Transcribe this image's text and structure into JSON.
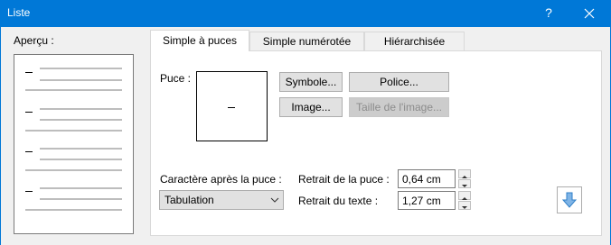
{
  "window": {
    "title": "Liste",
    "help_label": "?"
  },
  "preview": {
    "label": "Aperçu :"
  },
  "tabs": [
    {
      "label": "Simple à puces",
      "active": true
    },
    {
      "label": "Simple numérotée",
      "active": false
    },
    {
      "label": "Hiérarchisée",
      "active": false
    }
  ],
  "bullet": {
    "label": "Puce :",
    "symbol": "–"
  },
  "buttons": {
    "symbol": "Symbole...",
    "font": "Police...",
    "image": "Image...",
    "image_size": "Taille de l'image..."
  },
  "after_bullet": {
    "label": "Caractère après la puce :",
    "value": "Tabulation"
  },
  "indent_bullet": {
    "label": "Retrait de la puce :",
    "value": "0,64 cm"
  },
  "indent_text": {
    "label": "Retrait du texte :",
    "value": "1,27 cm"
  },
  "icons": {
    "close": "close-icon",
    "move_down": "arrow-down-icon",
    "dropdown": "chevron-down-icon"
  }
}
